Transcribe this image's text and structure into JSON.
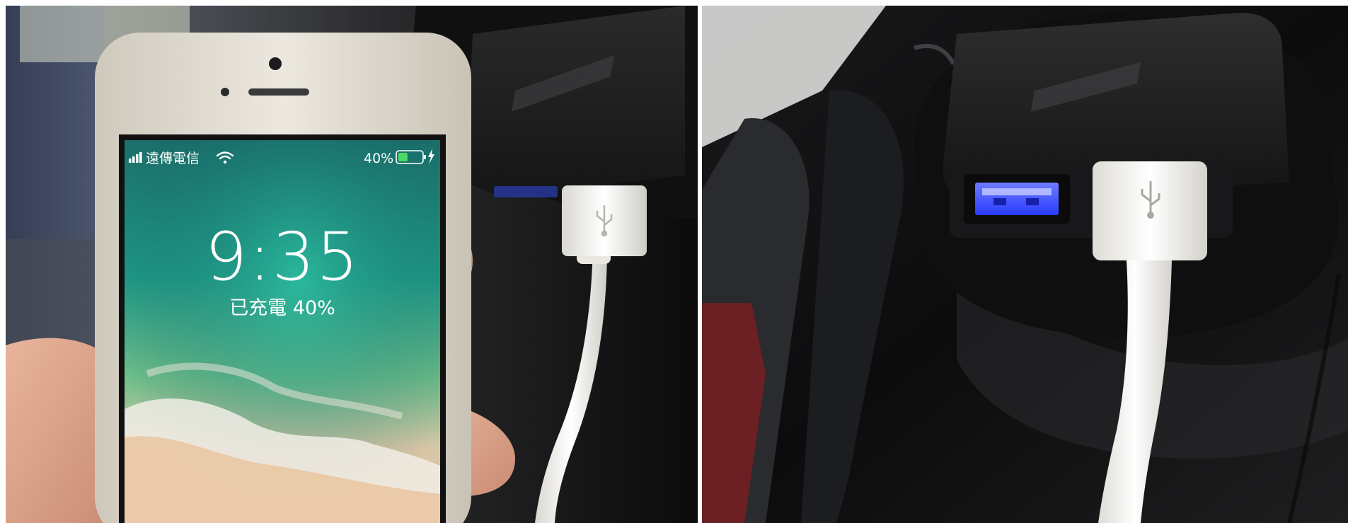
{
  "left_photo": {
    "carrier": "遠傳電信",
    "battery_percent_label": "40%",
    "battery_level": 0.4,
    "lock_time": "9:35",
    "charge_status": "已充電 40%",
    "icons": [
      "signal-bars-icon",
      "wifi-icon",
      "battery-icon",
      "charging-bolt-icon",
      "usb-trident-icon"
    ]
  },
  "right_photo": {
    "icons": [
      "usb-trident-icon"
    ]
  },
  "colors": {
    "battery_fill": "#4cd964",
    "port_led": "#3a4dff"
  }
}
